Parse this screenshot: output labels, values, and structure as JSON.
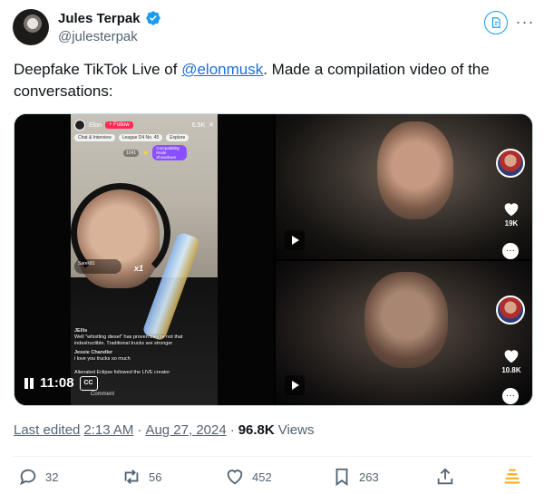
{
  "author": {
    "display_name": "Jules Terpak",
    "handle": "@julesterpak"
  },
  "tweet": {
    "text_before": "Deepfake TikTok Live of ",
    "mention": "@elonmusk",
    "text_after": ". Made a compilation video of the conversations:"
  },
  "media": {
    "video_time": "11:08",
    "cc_label": "CC",
    "tiktok": {
      "streamer": "Elon",
      "follow_label": "+ Follow",
      "viewer_count": "6.5K",
      "chips": [
        "Chat & Interview",
        "League D4 No. 45",
        "Explore"
      ],
      "score": "1241",
      "badge": "Compatibility Mode Showdown",
      "gift_user": "Sarek81",
      "gift_count": "x1",
      "chat": [
        {
          "user": "JEllis",
          "text": "Well \"whistling diesel\" has proven they're not that indestructible. Traditional trucks are stronger"
        },
        {
          "user": "Jessie Chandler",
          "text": "i love you trucks so much"
        },
        {
          "user": "",
          "text": "Alienated Eclipse followed the LIVE creator"
        }
      ],
      "comment_label": "Comment"
    },
    "right_top_likes": "19K",
    "right_bot_likes": "10.8K"
  },
  "meta": {
    "last_edited": "Last edited",
    "time": "2:13 AM",
    "separator_1": "·",
    "date": "Aug 27, 2024",
    "separator_2": "·",
    "views_count": "96.8K",
    "views_label": "Views"
  },
  "actions": {
    "replies": "32",
    "reposts": "56",
    "likes": "452",
    "bookmarks": "263"
  },
  "colors": {
    "accent_blue": "#1d9bf0",
    "mention_blue": "#1d6fd8",
    "text_secondary": "#536471",
    "bookmark_yellow": "#ffad1f"
  }
}
